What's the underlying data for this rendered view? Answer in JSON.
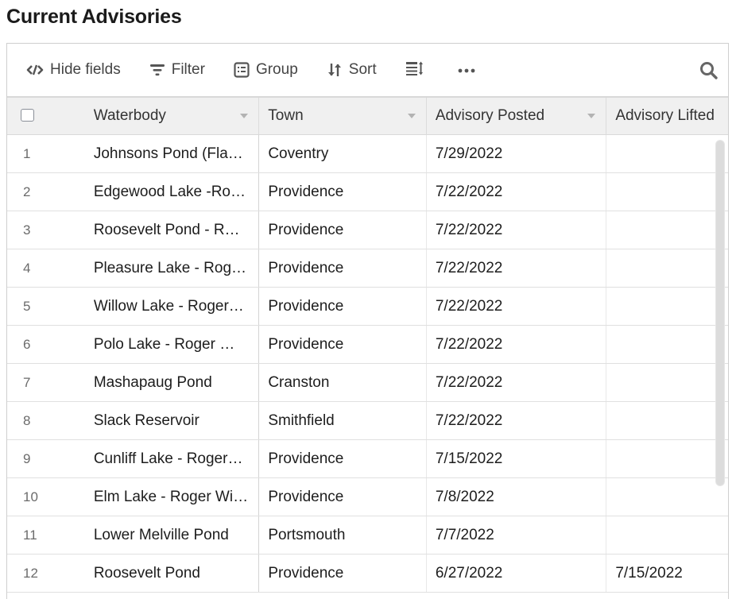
{
  "page": {
    "title": "Current Advisories"
  },
  "toolbar": {
    "hide_fields": "Hide fields",
    "filter": "Filter",
    "group": "Group",
    "sort": "Sort",
    "icons": [
      "hide-fields-icon",
      "filter-icon",
      "group-icon",
      "sort-icon",
      "row-height-icon",
      "more-icon",
      "search-icon"
    ]
  },
  "table": {
    "columns": [
      "Waterbody",
      "Town",
      "Advisory Posted",
      "Advisory Lifted"
    ],
    "rows": [
      {
        "num": "1",
        "waterbody": "Johnsons Pond (Fla…",
        "town": "Coventry",
        "posted": "7/29/2022",
        "lifted": ""
      },
      {
        "num": "2",
        "waterbody": "Edgewood Lake -Ro…",
        "town": "Providence",
        "posted": "7/22/2022",
        "lifted": ""
      },
      {
        "num": "3",
        "waterbody": "Roosevelt Pond - R…",
        "town": "Providence",
        "posted": "7/22/2022",
        "lifted": ""
      },
      {
        "num": "4",
        "waterbody": "Pleasure Lake - Rog…",
        "town": "Providence",
        "posted": "7/22/2022",
        "lifted": ""
      },
      {
        "num": "5",
        "waterbody": "Willow Lake - Roger…",
        "town": "Providence",
        "posted": "7/22/2022",
        "lifted": ""
      },
      {
        "num": "6",
        "waterbody": "Polo Lake - Roger …",
        "town": "Providence",
        "posted": "7/22/2022",
        "lifted": ""
      },
      {
        "num": "7",
        "waterbody": "Mashapaug Pond",
        "town": "Cranston",
        "posted": "7/22/2022",
        "lifted": ""
      },
      {
        "num": "8",
        "waterbody": "Slack Reservoir",
        "town": "Smithfield",
        "posted": "7/22/2022",
        "lifted": ""
      },
      {
        "num": "9",
        "waterbody": "Cunliff Lake - Roger…",
        "town": "Providence",
        "posted": "7/15/2022",
        "lifted": ""
      },
      {
        "num": "10",
        "waterbody": "Elm Lake - Roger Wi…",
        "town": "Providence",
        "posted": "7/8/2022",
        "lifted": ""
      },
      {
        "num": "11",
        "waterbody": "Lower Melville Pond",
        "town": "Portsmouth",
        "posted": "7/7/2022",
        "lifted": ""
      },
      {
        "num": "12",
        "waterbody": "Roosevelt Pond",
        "town": "Providence",
        "posted": "6/27/2022",
        "lifted": "7/15/2022"
      }
    ]
  }
}
